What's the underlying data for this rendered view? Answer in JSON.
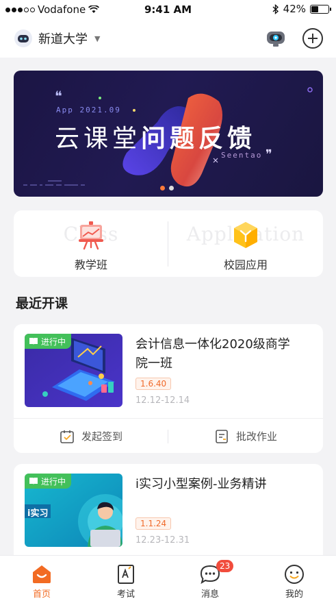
{
  "status_bar": {
    "carrier": "Vodafone",
    "time": "9:41 AM",
    "battery": "42%",
    "battery_level": 0.42
  },
  "header": {
    "school_name": "新道大学",
    "scan_icon": "robot-camera-icon",
    "add_icon": "plus-circle-icon"
  },
  "banner": {
    "subtitle": "App 2021.09",
    "title_light": "云课堂",
    "title_bold": "问题反馈",
    "brand": "Seentao",
    "active_index": 0,
    "slide_count": 2
  },
  "quick_entries": [
    {
      "label": "教学班",
      "watermark": "Class",
      "icon": "presentation-board-icon",
      "color": "#f05a4f"
    },
    {
      "label": "校园应用",
      "watermark": "Application",
      "icon": "cube-icon",
      "color": "#ffb300"
    }
  ],
  "recent_section": {
    "title": "最近开课"
  },
  "courses": [
    {
      "status": "进行中",
      "title": "会计信息一体化2020级商学院一班",
      "version": "1.6.40",
      "dates": "12.12-12.14",
      "actions": [
        {
          "label": "发起签到",
          "icon": "check-in-icon"
        },
        {
          "label": "批改作业",
          "icon": "grade-homework-icon"
        }
      ]
    },
    {
      "status": "进行中",
      "title": "i实习小型案例-业务精讲",
      "thumb_text": "i实习",
      "version": "1.1.24",
      "dates": "12.23-12.31"
    }
  ],
  "tabs": [
    {
      "label": "首页",
      "icon": "home-icon",
      "active": true
    },
    {
      "label": "考试",
      "icon": "exam-icon",
      "active": false
    },
    {
      "label": "消息",
      "icon": "message-icon",
      "active": false,
      "badge": "23"
    },
    {
      "label": "我的",
      "icon": "profile-smile-icon",
      "active": false
    }
  ],
  "colors": {
    "accent": "#f26b23",
    "status_green": "#43c05a",
    "badge_red": "#f14c3c"
  }
}
